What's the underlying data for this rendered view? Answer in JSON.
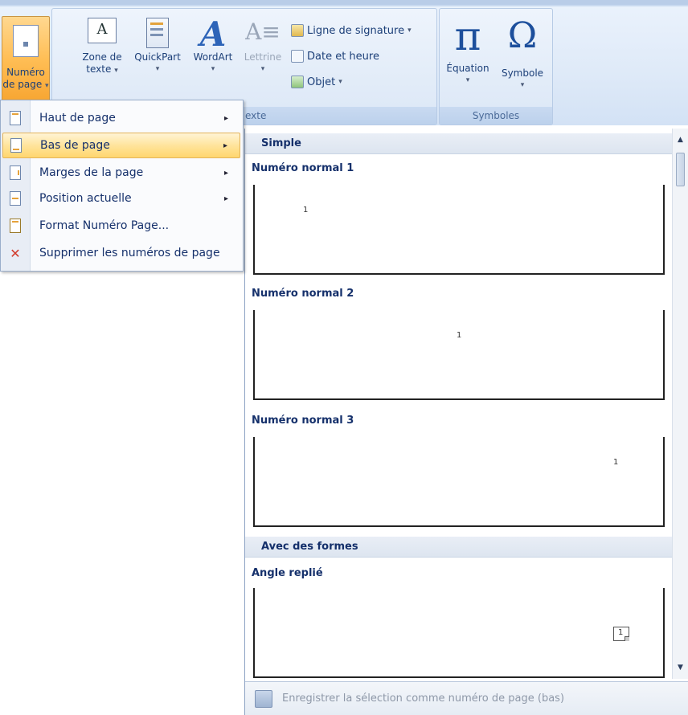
{
  "ribbon": {
    "numero_page": {
      "line1": "Numéro",
      "line2": "de page",
      "caret": "▾"
    },
    "zone_texte": {
      "line1": "Zone de",
      "line2": "texte",
      "caret": "▾"
    },
    "quickpart": {
      "label": "QuickPart",
      "caret": "▾"
    },
    "wordart": {
      "label": "WordArt",
      "caret": "▾"
    },
    "lettrine": {
      "label": "Lettrine",
      "caret": "▾"
    },
    "ligne_signature": {
      "label": "Ligne de signature",
      "caret": "▾"
    },
    "date_heure": {
      "label": "Date et heure"
    },
    "objet": {
      "label": "Objet",
      "caret": "▾"
    },
    "texte_group_label": "exte",
    "equation": {
      "label": "Équation",
      "glyph": "π",
      "caret": "▾"
    },
    "symbole": {
      "label": "Symbole",
      "glyph": "Ω",
      "caret": "▾"
    },
    "symboles_group_label": "Symboles"
  },
  "menu": {
    "items": [
      {
        "label": "Haut de page",
        "submenu": true
      },
      {
        "label": "Bas de page",
        "submenu": true,
        "highlighted": true
      },
      {
        "label": "Marges de la page",
        "submenu": true
      },
      {
        "label": "Position actuelle",
        "submenu": true
      },
      {
        "label": "Format Numéro Page...",
        "submenu": false
      },
      {
        "label": "Supprimer les numéros de page",
        "submenu": false
      }
    ],
    "arrow_glyph": "▸"
  },
  "gallery": {
    "section_simple": "Simple",
    "item1": {
      "title": "Numéro normal 1",
      "page_number": "1"
    },
    "item2": {
      "title": "Numéro normal 2",
      "page_number": "1"
    },
    "item3": {
      "title": "Numéro normal 3",
      "page_number": "1"
    },
    "section_formes": "Avec des formes",
    "item4": {
      "title": "Angle replié",
      "page_number": "1"
    },
    "scroll_up": "▲",
    "scroll_down": "▼",
    "footer_label": "Enregistrer la sélection comme numéro de page (bas)"
  },
  "colors": {
    "accent_orange": "#ffbe55",
    "ribbon_blue": "#dfeaf8",
    "text_navy": "#15306b"
  }
}
